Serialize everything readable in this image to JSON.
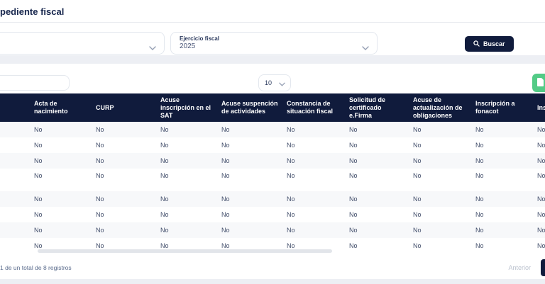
{
  "page": {
    "title": "pediente fiscal"
  },
  "filters": {
    "year_label": "Ejercicio fiscal",
    "year_value": "2025",
    "search_label": "Buscar"
  },
  "toolbar": {
    "search_value": "",
    "page_size": "10",
    "export_icon": "excel-file-icon"
  },
  "table": {
    "headers": [
      "",
      "Acta de nacimiento",
      "CURP",
      "Acuse inscripción en el SAT",
      "Acuse suspención de actividades",
      "Constancia de situación fiscal",
      "Solicitud de certificado e.Firma",
      "Acuse de actualización de obligaciones",
      "Inscripción a fonacot",
      "Ins"
    ],
    "rows": [
      [
        "",
        "No",
        "No",
        "No",
        "No",
        "No",
        "No",
        "No",
        "No",
        "No"
      ],
      [
        "",
        "No",
        "No",
        "No",
        "No",
        "No",
        "No",
        "No",
        "No",
        "No"
      ],
      [
        "",
        "No",
        "No",
        "No",
        "No",
        "No",
        "No",
        "No",
        "No",
        "No"
      ],
      [
        "",
        "No",
        "No",
        "No",
        "No",
        "No",
        "No",
        "No",
        "No",
        "No"
      ],
      [
        "",
        "No",
        "No",
        "No",
        "No",
        "No",
        "No",
        "No",
        "No",
        "No"
      ],
      [
        "",
        "No",
        "No",
        "No",
        "No",
        "No",
        "No",
        "No",
        "No",
        "No"
      ],
      [
        "",
        "No",
        "No",
        "No",
        "No",
        "No",
        "No",
        "No",
        "No",
        "No"
      ],
      [
        "",
        "No",
        "No",
        "No",
        "No",
        "No",
        "No",
        "No",
        "No",
        "No"
      ]
    ]
  },
  "pagination": {
    "info": "1 de un total de 8 registros",
    "previous_label": "Anterior"
  },
  "colors": {
    "navy": "#101b3c",
    "green": "#53cb86",
    "page_background": "#edeff4",
    "row_stripe": "#f7f8fa",
    "header_text": "#ffffff"
  }
}
